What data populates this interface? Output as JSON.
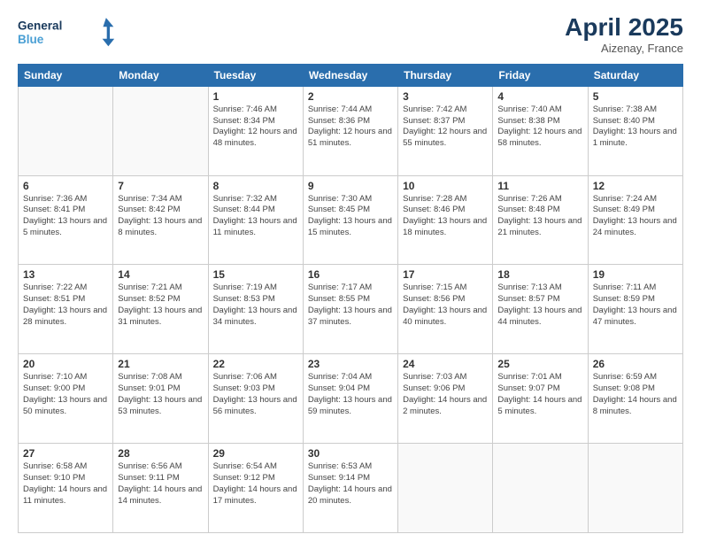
{
  "header": {
    "logo_general": "General",
    "logo_blue": "Blue",
    "month_year": "April 2025",
    "location": "Aizenay, France"
  },
  "weekdays": [
    "Sunday",
    "Monday",
    "Tuesday",
    "Wednesday",
    "Thursday",
    "Friday",
    "Saturday"
  ],
  "weeks": [
    [
      {
        "day": "",
        "info": ""
      },
      {
        "day": "",
        "info": ""
      },
      {
        "day": "1",
        "info": "Sunrise: 7:46 AM\nSunset: 8:34 PM\nDaylight: 12 hours and 48 minutes."
      },
      {
        "day": "2",
        "info": "Sunrise: 7:44 AM\nSunset: 8:36 PM\nDaylight: 12 hours and 51 minutes."
      },
      {
        "day": "3",
        "info": "Sunrise: 7:42 AM\nSunset: 8:37 PM\nDaylight: 12 hours and 55 minutes."
      },
      {
        "day": "4",
        "info": "Sunrise: 7:40 AM\nSunset: 8:38 PM\nDaylight: 12 hours and 58 minutes."
      },
      {
        "day": "5",
        "info": "Sunrise: 7:38 AM\nSunset: 8:40 PM\nDaylight: 13 hours and 1 minute."
      }
    ],
    [
      {
        "day": "6",
        "info": "Sunrise: 7:36 AM\nSunset: 8:41 PM\nDaylight: 13 hours and 5 minutes."
      },
      {
        "day": "7",
        "info": "Sunrise: 7:34 AM\nSunset: 8:42 PM\nDaylight: 13 hours and 8 minutes."
      },
      {
        "day": "8",
        "info": "Sunrise: 7:32 AM\nSunset: 8:44 PM\nDaylight: 13 hours and 11 minutes."
      },
      {
        "day": "9",
        "info": "Sunrise: 7:30 AM\nSunset: 8:45 PM\nDaylight: 13 hours and 15 minutes."
      },
      {
        "day": "10",
        "info": "Sunrise: 7:28 AM\nSunset: 8:46 PM\nDaylight: 13 hours and 18 minutes."
      },
      {
        "day": "11",
        "info": "Sunrise: 7:26 AM\nSunset: 8:48 PM\nDaylight: 13 hours and 21 minutes."
      },
      {
        "day": "12",
        "info": "Sunrise: 7:24 AM\nSunset: 8:49 PM\nDaylight: 13 hours and 24 minutes."
      }
    ],
    [
      {
        "day": "13",
        "info": "Sunrise: 7:22 AM\nSunset: 8:51 PM\nDaylight: 13 hours and 28 minutes."
      },
      {
        "day": "14",
        "info": "Sunrise: 7:21 AM\nSunset: 8:52 PM\nDaylight: 13 hours and 31 minutes."
      },
      {
        "day": "15",
        "info": "Sunrise: 7:19 AM\nSunset: 8:53 PM\nDaylight: 13 hours and 34 minutes."
      },
      {
        "day": "16",
        "info": "Sunrise: 7:17 AM\nSunset: 8:55 PM\nDaylight: 13 hours and 37 minutes."
      },
      {
        "day": "17",
        "info": "Sunrise: 7:15 AM\nSunset: 8:56 PM\nDaylight: 13 hours and 40 minutes."
      },
      {
        "day": "18",
        "info": "Sunrise: 7:13 AM\nSunset: 8:57 PM\nDaylight: 13 hours and 44 minutes."
      },
      {
        "day": "19",
        "info": "Sunrise: 7:11 AM\nSunset: 8:59 PM\nDaylight: 13 hours and 47 minutes."
      }
    ],
    [
      {
        "day": "20",
        "info": "Sunrise: 7:10 AM\nSunset: 9:00 PM\nDaylight: 13 hours and 50 minutes."
      },
      {
        "day": "21",
        "info": "Sunrise: 7:08 AM\nSunset: 9:01 PM\nDaylight: 13 hours and 53 minutes."
      },
      {
        "day": "22",
        "info": "Sunrise: 7:06 AM\nSunset: 9:03 PM\nDaylight: 13 hours and 56 minutes."
      },
      {
        "day": "23",
        "info": "Sunrise: 7:04 AM\nSunset: 9:04 PM\nDaylight: 13 hours and 59 minutes."
      },
      {
        "day": "24",
        "info": "Sunrise: 7:03 AM\nSunset: 9:06 PM\nDaylight: 14 hours and 2 minutes."
      },
      {
        "day": "25",
        "info": "Sunrise: 7:01 AM\nSunset: 9:07 PM\nDaylight: 14 hours and 5 minutes."
      },
      {
        "day": "26",
        "info": "Sunrise: 6:59 AM\nSunset: 9:08 PM\nDaylight: 14 hours and 8 minutes."
      }
    ],
    [
      {
        "day": "27",
        "info": "Sunrise: 6:58 AM\nSunset: 9:10 PM\nDaylight: 14 hours and 11 minutes."
      },
      {
        "day": "28",
        "info": "Sunrise: 6:56 AM\nSunset: 9:11 PM\nDaylight: 14 hours and 14 minutes."
      },
      {
        "day": "29",
        "info": "Sunrise: 6:54 AM\nSunset: 9:12 PM\nDaylight: 14 hours and 17 minutes."
      },
      {
        "day": "30",
        "info": "Sunrise: 6:53 AM\nSunset: 9:14 PM\nDaylight: 14 hours and 20 minutes."
      },
      {
        "day": "",
        "info": ""
      },
      {
        "day": "",
        "info": ""
      },
      {
        "day": "",
        "info": ""
      }
    ]
  ]
}
